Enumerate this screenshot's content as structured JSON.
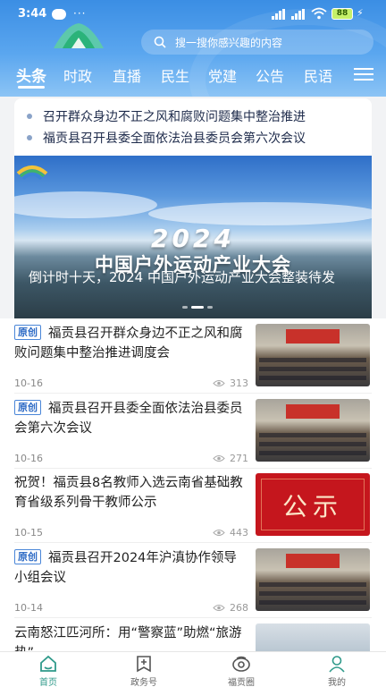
{
  "status_bar": {
    "time": "3:44",
    "battery": "88",
    "dots": "···"
  },
  "search": {
    "placeholder": "搜一搜你感兴趣的内容"
  },
  "tabs": [
    {
      "label": "头条",
      "active": true
    },
    {
      "label": "时政"
    },
    {
      "label": "直播"
    },
    {
      "label": "民生"
    },
    {
      "label": "党建"
    },
    {
      "label": "公告"
    },
    {
      "label": "民语"
    }
  ],
  "ticker": [
    "召开群众身边不正之风和腐败问题集中整治推进",
    "福贡县召开县委全面依法治县委员会第六次会议"
  ],
  "banner": {
    "year_text": "2024",
    "title_text": "中国户外运动产业大会",
    "caption": "倒计时十天，2024 中国户外运动产业大会整装待发"
  },
  "news": [
    {
      "tag": "原创",
      "title": "福贡县召开群众身边不正之风和腐败问题集中整治推进调度会",
      "date": "10-16",
      "views": "313",
      "thumb": "meeting"
    },
    {
      "tag": "原创",
      "title": "福贡县召开县委全面依法治县委员会第六次会议",
      "date": "10-16",
      "views": "271",
      "thumb": "meeting"
    },
    {
      "tag": "",
      "title": "祝贺！福贡县8名教师入选云南省基础教育省级系列骨干教师公示",
      "date": "10-15",
      "views": "443",
      "thumb": "notice",
      "thumb_text": "公示"
    },
    {
      "tag": "原创",
      "title": "福贡县召开2024年沪滇协作领导小组会议",
      "date": "10-14",
      "views": "268",
      "thumb": "meeting"
    },
    {
      "tag": "",
      "title": "云南怒江匹河所：用“警察蓝”助燃“旅游热”",
      "date": "",
      "views": "",
      "thumb": "mountain"
    }
  ],
  "bottom_nav": [
    {
      "label": "首页",
      "icon": "home-icon",
      "active": true
    },
    {
      "label": "政务号",
      "icon": "bookmark-add-icon"
    },
    {
      "label": "福贡圈",
      "icon": "circle-icon"
    },
    {
      "label": "我的",
      "icon": "user-icon"
    }
  ],
  "colors": {
    "header_blue": "#3b8ee4",
    "tag_blue": "#2f6cc6",
    "active_nav": "#2f9a8a",
    "notice_red": "#c5161d"
  }
}
